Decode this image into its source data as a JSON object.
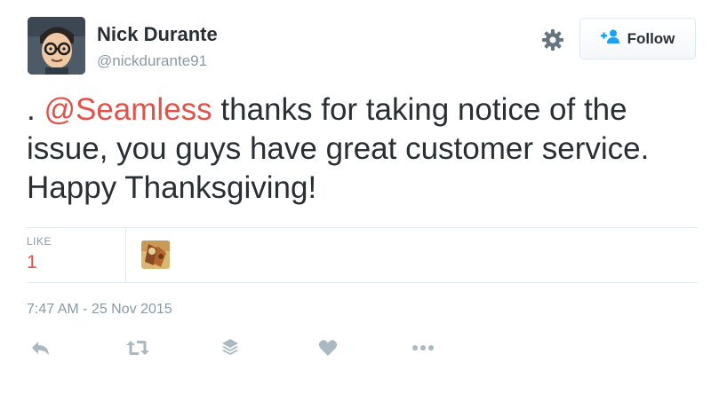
{
  "user": {
    "name": "Nick Durante",
    "handle": "@nickdurante91"
  },
  "follow_button": {
    "label": "Follow"
  },
  "tweet": {
    "prefix": ". ",
    "mention": "@Seamless",
    "text": " thanks for taking notice of the issue, you guys have great customer service. Happy Thanksgiving!"
  },
  "stats": {
    "likes_label": "LIKE",
    "likes_count": "1"
  },
  "timestamp": "7:47 AM - 25 Nov 2015",
  "colors": {
    "mention": "#e0534a",
    "likes_count": "#e0534a",
    "muted": "#8899a6",
    "follow_icon": "#1da1f2",
    "action_icons": "#aab8c2"
  },
  "icons": {
    "settings": "gear-icon",
    "follow": "add-user-icon",
    "reply": "reply-icon",
    "retweet": "retweet-icon",
    "stack": "layers-icon",
    "like": "heart-icon",
    "more": "more-dots-icon"
  }
}
